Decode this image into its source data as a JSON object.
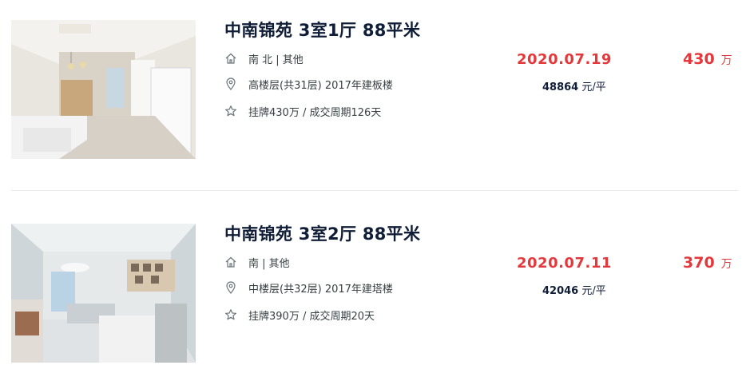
{
  "listings": [
    {
      "title": "中南锦苑 3室1厅 88平米",
      "house_info": "南 北 | 其他",
      "position_info": "高楼层(共31层) 2017年建板楼",
      "deal_cycle": "挂牌430万 / 成交周期126天",
      "deal_date": "2020.07.19",
      "unit_price_num": "48864",
      "unit_price_unit": "元/平",
      "total_price_num": "430",
      "total_price_unit": "万",
      "icons": {
        "house": "house-icon",
        "position": "location-pin-icon",
        "deal": "star-icon"
      }
    },
    {
      "title": "中南锦苑 3室2厅 88平米",
      "house_info": "南 | 其他",
      "position_info": "中楼层(共32层) 2017年建塔楼",
      "deal_cycle": "挂牌390万 / 成交周期20天",
      "deal_date": "2020.07.11",
      "unit_price_num": "42046",
      "unit_price_unit": "元/平",
      "total_price_num": "370",
      "total_price_unit": "万",
      "icons": {
        "house": "house-icon",
        "position": "location-pin-icon",
        "deal": "star-icon"
      }
    }
  ],
  "colors": {
    "title": "#101d37",
    "accent_red": "#e4393c",
    "text": "#394043",
    "divider": "#e8eaed"
  }
}
